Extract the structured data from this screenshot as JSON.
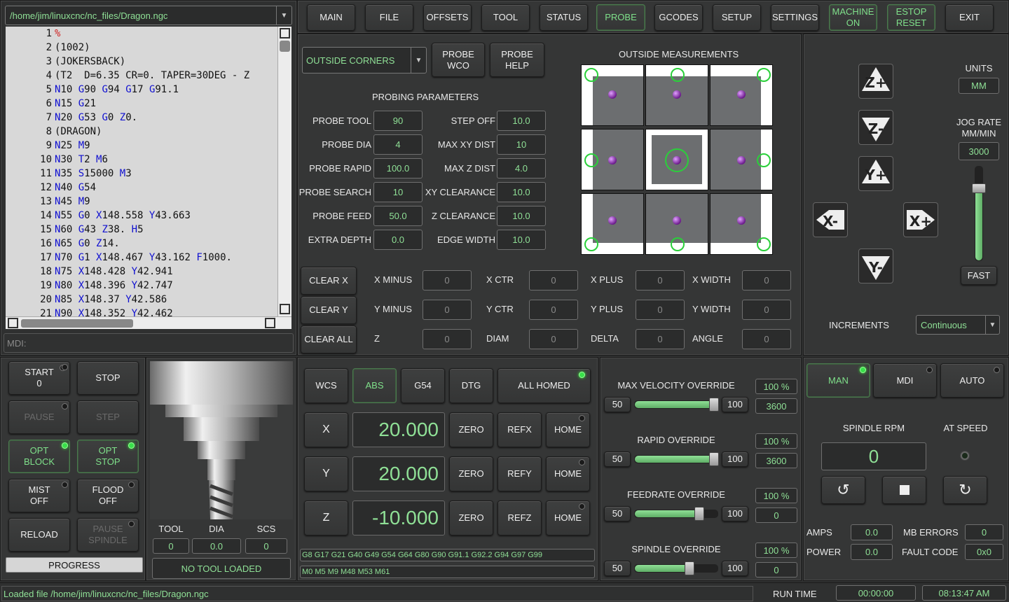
{
  "file_path": "/home/jim/linuxcnc/nc_files/Dragon.ngc",
  "gcode_lines": [
    {
      "n": "1",
      "t": [
        [
          "pct",
          "%"
        ]
      ]
    },
    {
      "n": "2",
      "t": [
        [
          "",
          "(1002)"
        ]
      ]
    },
    {
      "n": "3",
      "t": [
        [
          "",
          "(JOKERSBACK)"
        ]
      ]
    },
    {
      "n": "4",
      "t": [
        [
          "",
          "(T2  D=6.35 CR=0. TAPER=30DEG - Z"
        ]
      ]
    },
    {
      "n": "5",
      "t": [
        [
          "kw",
          "N"
        ],
        [
          "",
          "10 "
        ],
        [
          "kw",
          "G"
        ],
        [
          "",
          "90 "
        ],
        [
          "kw",
          "G"
        ],
        [
          "",
          "94 "
        ],
        [
          "kw",
          "G"
        ],
        [
          "",
          "17 "
        ],
        [
          "kw",
          "G"
        ],
        [
          "",
          "91.1"
        ]
      ]
    },
    {
      "n": "6",
      "t": [
        [
          "kw",
          "N"
        ],
        [
          "",
          "15 "
        ],
        [
          "kw",
          "G"
        ],
        [
          "",
          "21"
        ]
      ]
    },
    {
      "n": "7",
      "t": [
        [
          "kw",
          "N"
        ],
        [
          "",
          "20 "
        ],
        [
          "kw",
          "G"
        ],
        [
          "",
          "53 "
        ],
        [
          "kw",
          "G"
        ],
        [
          "",
          "0 "
        ],
        [
          "kw",
          "Z"
        ],
        [
          "",
          "0."
        ]
      ]
    },
    {
      "n": "8",
      "t": [
        [
          "",
          "(DRAGON)"
        ]
      ]
    },
    {
      "n": "9",
      "t": [
        [
          "kw",
          "N"
        ],
        [
          "",
          "25 "
        ],
        [
          "kw",
          "M"
        ],
        [
          "",
          "9"
        ]
      ]
    },
    {
      "n": "10",
      "t": [
        [
          "kw",
          "N"
        ],
        [
          "",
          "30 "
        ],
        [
          "kw",
          "T"
        ],
        [
          "",
          "2 "
        ],
        [
          "kw",
          "M"
        ],
        [
          "",
          "6"
        ]
      ]
    },
    {
      "n": "11",
      "t": [
        [
          "kw",
          "N"
        ],
        [
          "",
          "35 "
        ],
        [
          "kw",
          "S"
        ],
        [
          "",
          "15000 "
        ],
        [
          "kw",
          "M"
        ],
        [
          "",
          "3"
        ]
      ]
    },
    {
      "n": "12",
      "t": [
        [
          "kw",
          "N"
        ],
        [
          "",
          "40 "
        ],
        [
          "kw",
          "G"
        ],
        [
          "",
          "54"
        ]
      ]
    },
    {
      "n": "13",
      "t": [
        [
          "kw",
          "N"
        ],
        [
          "",
          "45 "
        ],
        [
          "kw",
          "M"
        ],
        [
          "",
          "9"
        ]
      ]
    },
    {
      "n": "14",
      "t": [
        [
          "kw",
          "N"
        ],
        [
          "",
          "55 "
        ],
        [
          "kw",
          "G"
        ],
        [
          "",
          "0 "
        ],
        [
          "kw",
          "X"
        ],
        [
          "",
          "148.558 "
        ],
        [
          "kw",
          "Y"
        ],
        [
          "",
          "43.663"
        ]
      ]
    },
    {
      "n": "15",
      "t": [
        [
          "kw",
          "N"
        ],
        [
          "",
          "60 "
        ],
        [
          "kw",
          "G"
        ],
        [
          "",
          "43 "
        ],
        [
          "kw",
          "Z"
        ],
        [
          "",
          "38. "
        ],
        [
          "kw",
          "H"
        ],
        [
          "",
          "5"
        ]
      ]
    },
    {
      "n": "16",
      "t": [
        [
          "kw",
          "N"
        ],
        [
          "",
          "65 "
        ],
        [
          "kw",
          "G"
        ],
        [
          "",
          "0 "
        ],
        [
          "kw",
          "Z"
        ],
        [
          "",
          "14."
        ]
      ]
    },
    {
      "n": "17",
      "t": [
        [
          "kw",
          "N"
        ],
        [
          "",
          "70 "
        ],
        [
          "kw",
          "G"
        ],
        [
          "",
          "1 "
        ],
        [
          "kw",
          "X"
        ],
        [
          "",
          "148.467 "
        ],
        [
          "kw",
          "Y"
        ],
        [
          "",
          "43.162 "
        ],
        [
          "kw",
          "F"
        ],
        [
          "",
          "1000."
        ]
      ]
    },
    {
      "n": "18",
      "t": [
        [
          "kw",
          "N"
        ],
        [
          "",
          "75 "
        ],
        [
          "kw",
          "X"
        ],
        [
          "",
          "148.428 "
        ],
        [
          "kw",
          "Y"
        ],
        [
          "",
          "42.941"
        ]
      ]
    },
    {
      "n": "19",
      "t": [
        [
          "kw",
          "N"
        ],
        [
          "",
          "80 "
        ],
        [
          "kw",
          "X"
        ],
        [
          "",
          "148.396 "
        ],
        [
          "kw",
          "Y"
        ],
        [
          "",
          "42.747"
        ]
      ]
    },
    {
      "n": "20",
      "t": [
        [
          "kw",
          "N"
        ],
        [
          "",
          "85 "
        ],
        [
          "kw",
          "X"
        ],
        [
          "",
          "148.37 "
        ],
        [
          "kw",
          "Y"
        ],
        [
          "",
          "42.586"
        ]
      ]
    },
    {
      "n": "21",
      "t": [
        [
          "kw",
          "N"
        ],
        [
          "",
          "90 "
        ],
        [
          "kw",
          "X"
        ],
        [
          "",
          "148.352 "
        ],
        [
          "kw",
          "Y"
        ],
        [
          "",
          "42.462"
        ]
      ]
    }
  ],
  "mdi_placeholder": "MDI:",
  "tabs": [
    {
      "label": "MAIN",
      "name": "tab-main",
      "active": false
    },
    {
      "label": "FILE",
      "name": "tab-file",
      "active": false
    },
    {
      "label": "OFFSETS",
      "name": "tab-offsets",
      "active": false
    },
    {
      "label": "TOOL",
      "name": "tab-tool",
      "active": false
    },
    {
      "label": "STATUS",
      "name": "tab-status",
      "active": false
    },
    {
      "label": "PROBE",
      "name": "tab-probe",
      "active": true
    },
    {
      "label": "GCODES",
      "name": "tab-gcodes",
      "active": false
    },
    {
      "label": "SETUP",
      "name": "tab-setup",
      "active": false
    },
    {
      "label": "SETTINGS",
      "name": "tab-settings",
      "active": false
    },
    {
      "label": "MACHINE\nON",
      "name": "machine-on-button",
      "active": true
    },
    {
      "label": "ESTOP\nRESET",
      "name": "estop-reset-button",
      "active": true
    },
    {
      "label": "EXIT",
      "name": "exit-button",
      "active": false
    }
  ],
  "probe": {
    "mode": "OUTSIDE CORNERS",
    "probe_wco": "PROBE\nWCO",
    "probe_help": "PROBE\nHELP",
    "params_title": "PROBING PARAMETERS",
    "measure_title": "OUTSIDE MEASUREMENTS",
    "params_left": [
      {
        "label": "PROBE TOOL",
        "value": "90"
      },
      {
        "label": "PROBE DIA",
        "value": "4"
      },
      {
        "label": "PROBE RAPID",
        "value": "100.0"
      },
      {
        "label": "PROBE SEARCH",
        "value": "10"
      },
      {
        "label": "PROBE FEED",
        "value": "50.0"
      },
      {
        "label": "EXTRA DEPTH",
        "value": "0.0"
      }
    ],
    "params_right": [
      {
        "label": "STEP OFF",
        "value": "10.0"
      },
      {
        "label": "MAX XY DIST",
        "value": "10"
      },
      {
        "label": "MAX Z DIST",
        "value": "4.0"
      },
      {
        "label": "XY CLEARANCE",
        "value": "10.0"
      },
      {
        "label": "Z CLEARANCE",
        "value": "10.0"
      },
      {
        "label": "EDGE WIDTH",
        "value": "10.0"
      }
    ],
    "clear_buttons": [
      "CLEAR X",
      "CLEAR Y",
      "CLEAR ALL"
    ],
    "results": [
      [
        {
          "label": "X MINUS",
          "value": "0"
        },
        {
          "label": "X CTR",
          "value": "0"
        },
        {
          "label": "X PLUS",
          "value": "0"
        },
        {
          "label": "X WIDTH",
          "value": "0"
        }
      ],
      [
        {
          "label": "Y MINUS",
          "value": "0"
        },
        {
          "label": "Y CTR",
          "value": "0"
        },
        {
          "label": "Y PLUS",
          "value": "0"
        },
        {
          "label": "Y WIDTH",
          "value": "0"
        }
      ],
      [
        {
          "label": "Z",
          "value": "0"
        },
        {
          "label": "DIAM",
          "value": "0"
        },
        {
          "label": "DELTA",
          "value": "0"
        },
        {
          "label": "ANGLE",
          "value": "0"
        }
      ]
    ]
  },
  "jog": {
    "units_label": "UNITS",
    "units_value": "MM",
    "rate_label": "JOG RATE\nMM/MIN",
    "rate_value": "3000",
    "rate_level": 0.8,
    "fast": "FAST",
    "increments_label": "INCREMENTS",
    "increments_value": "Continuous",
    "buttons": [
      "Z+",
      "Z-",
      "Y+",
      "X-",
      "X+",
      "Y-"
    ]
  },
  "program": {
    "start": "START\n0",
    "stop": "STOP",
    "pause": "PAUSE",
    "step": "STEP",
    "opt_block": "OPT\nBLOCK",
    "opt_stop": "OPT\nSTOP",
    "mist": "MIST\nOFF",
    "flood": "FLOOD\nOFF",
    "reload": "RELOAD",
    "pause_spindle": "PAUSE\nSPINDLE",
    "progress": "PROGRESS"
  },
  "tool": {
    "headers": [
      "TOOL",
      "DIA",
      "SCS"
    ],
    "values": [
      "0",
      "0.0",
      "0"
    ],
    "status": "NO TOOL LOADED"
  },
  "dro": {
    "wcs": "WCS",
    "abs": "ABS",
    "g54": "G54",
    "dtg": "DTG",
    "all_homed": "ALL HOMED",
    "axes": [
      {
        "axis": "X",
        "value": "20.000",
        "zero": "ZERO",
        "ref": "REFX",
        "home": "HOME"
      },
      {
        "axis": "Y",
        "value": "20.000",
        "zero": "ZERO",
        "ref": "REFY",
        "home": "HOME"
      },
      {
        "axis": "Z",
        "value": "-10.000",
        "zero": "ZERO",
        "ref": "REFZ",
        "home": "HOME"
      }
    ],
    "gcodes": "G8 G17 G21 G40 G49 G54 G64 G80 G90 G91.1 G92.2 G94 G97 G99",
    "mcodes": "M0 M5 M9 M48 M53 M61"
  },
  "overrides": [
    {
      "title": "MAX VELOCITY OVERRIDE",
      "min": "50",
      "max": "100",
      "percent": "100 %",
      "value": "3600",
      "level": 1.0
    },
    {
      "title": "RAPID OVERRIDE",
      "min": "50",
      "max": "100",
      "percent": "100 %",
      "value": "3600",
      "level": 1.0
    },
    {
      "title": "FEEDRATE OVERRIDE",
      "min": "50",
      "max": "100",
      "percent": "100 %",
      "value": "0",
      "level": 0.8
    },
    {
      "title": "SPINDLE OVERRIDE",
      "min": "50",
      "max": "100",
      "percent": "100 %",
      "value": "0",
      "level": 0.67
    }
  ],
  "modes": [
    {
      "label": "MAN",
      "name": "man-mode-button",
      "active": true
    },
    {
      "label": "MDI",
      "name": "mdi-mode-button",
      "active": false
    },
    {
      "label": "AUTO",
      "name": "auto-mode-button",
      "active": false
    }
  ],
  "spindle": {
    "rpm_label": "SPINDLE RPM",
    "rpm_value": "0",
    "at_speed_label": "AT SPEED",
    "amps_label": "AMPS",
    "amps_value": "0.0",
    "power_label": "POWER",
    "power_value": "0.0",
    "mb_errors_label": "MB ERRORS",
    "mb_errors_value": "0",
    "fault_label": "FAULT CODE",
    "fault_value": "0x0"
  },
  "status": {
    "message": "Loaded file /home/jim/linuxcnc/nc_files/Dragon.ngc",
    "run_time_label": "RUN TIME",
    "run_time": "00:00:00",
    "clock": "08:13:47 AM"
  }
}
